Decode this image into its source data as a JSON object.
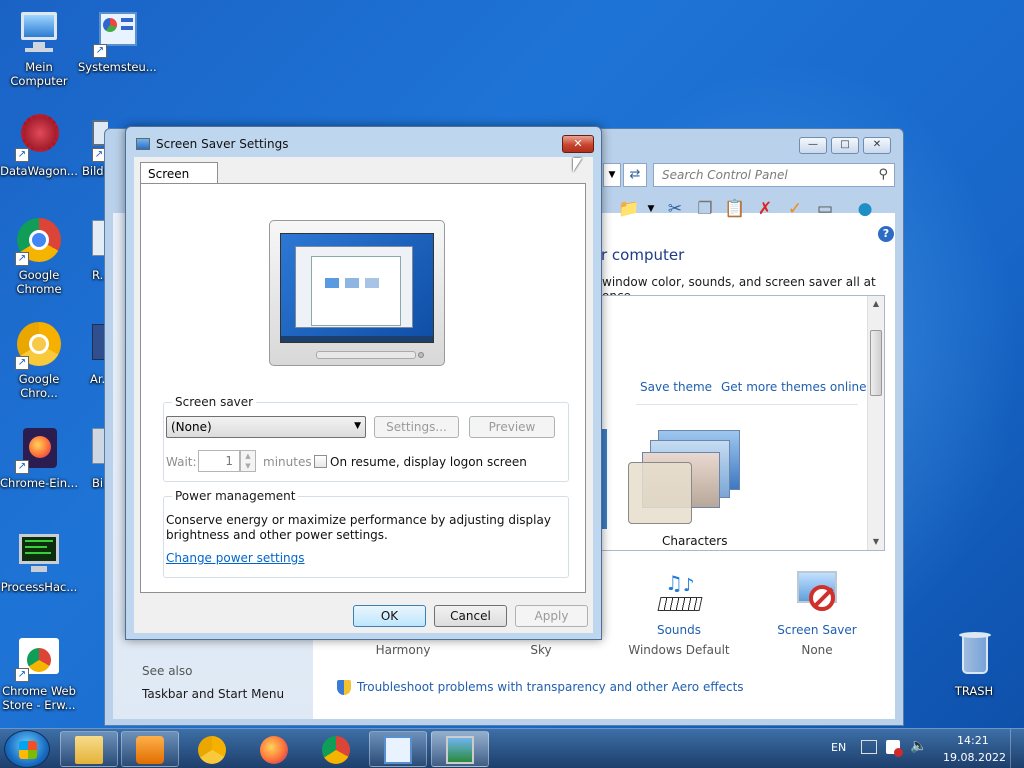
{
  "desktop": {
    "icons": [
      {
        "label": "Mein\nComputer"
      },
      {
        "label": "Systemsteu..."
      },
      {
        "label": "DataWagon..."
      },
      {
        "label": "Bilds..."
      },
      {
        "label": "Google\nChrome"
      },
      {
        "label": "R..."
      },
      {
        "label": "Google\nChro..."
      },
      {
        "label": "Ar..."
      },
      {
        "label": "Chrome-Ein..."
      },
      {
        "label": "Bi..."
      },
      {
        "label": "ProcessHac..."
      },
      {
        "label": "Chrome Web\nStore - Erw..."
      },
      {
        "label": "TRASH"
      }
    ]
  },
  "control_panel": {
    "search_placeholder": "Search Control Panel",
    "heading_partial": "r computer",
    "subtitle_partial": "window color, sounds, and screen saver all at once.",
    "save_theme": "Save theme",
    "get_more_themes": "Get more themes online",
    "theme_characters": "Characters",
    "items": [
      {
        "title": "Harmony",
        "sub": ""
      },
      {
        "title": "Sky",
        "sub": ""
      },
      {
        "title": "Sounds",
        "sub": "Windows Default"
      },
      {
        "title": "Screen Saver",
        "sub": "None"
      }
    ],
    "see_also": "See also",
    "taskbar_link": "Taskbar and Start Menu",
    "troubleshoot": "Troubleshoot problems with transparency and other Aero effects"
  },
  "dialog": {
    "title": "Screen Saver Settings",
    "tab": "Screen Saver",
    "screensaver_group": "Screen saver",
    "selected": "(None)",
    "settings_btn": "Settings...",
    "preview_btn": "Preview",
    "wait_label": "Wait:",
    "wait_value": "1",
    "minutes": "minutes",
    "resume_label": "On resume, display logon screen",
    "power_group": "Power management",
    "power_text_1": "Conserve energy or maximize performance by adjusting display",
    "power_text_2": "brightness and other power settings.",
    "change_power": "Change power settings",
    "ok": "OK",
    "cancel": "Cancel",
    "apply": "Apply"
  },
  "taskbar": {
    "language": "EN",
    "time": "14:21",
    "date": "19.08.2022"
  }
}
